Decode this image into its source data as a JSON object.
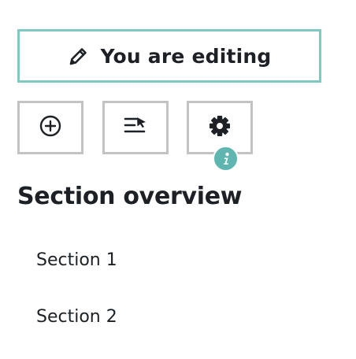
{
  "editing_banner": {
    "label": "You are editing",
    "icon": "pencil-icon"
  },
  "toolbar": {
    "buttons": [
      {
        "icon": "plus-circle-icon"
      },
      {
        "icon": "move-list-icon"
      },
      {
        "icon": "gear-icon"
      }
    ],
    "info_badge": {
      "icon": "info-icon",
      "glyph": "i"
    }
  },
  "section_overview": {
    "title": "Section overview",
    "items": [
      {
        "label": "Section 1"
      },
      {
        "label": "Section 2"
      }
    ]
  },
  "colors": {
    "banner_border": "#7fc9c2",
    "button_border": "#c3c3c3",
    "info_badge": "#5fb6b1",
    "text": "#1d2125"
  }
}
